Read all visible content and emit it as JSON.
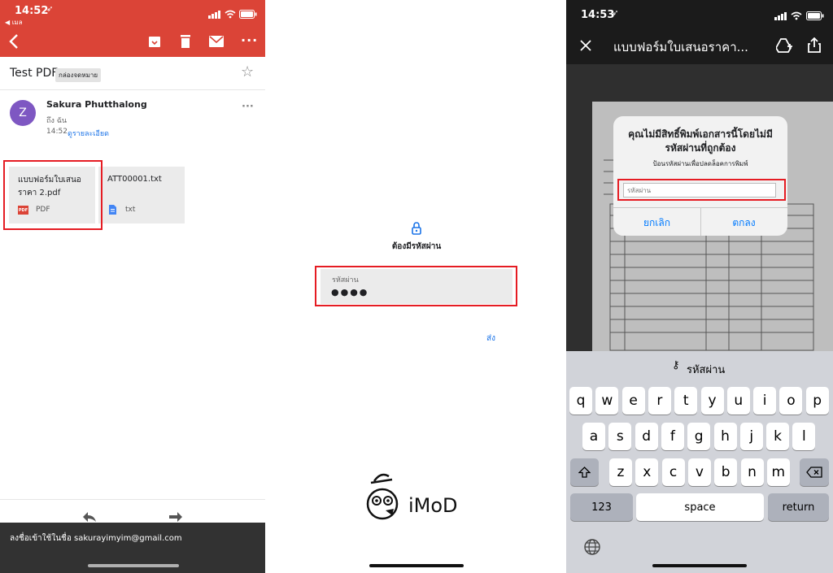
{
  "gmail": {
    "status": {
      "time": "14:52",
      "back_app": "◀ เมล"
    },
    "toolbar": {
      "back_icon": "chevron-left-icon",
      "archive_icon": "archive-icon",
      "delete_icon": "trash-icon",
      "mail_icon": "mail-icon",
      "more_icon": "more-icon"
    },
    "subject": "Test PDF",
    "label_badge": "กล่องจดหมาย",
    "sender": {
      "avatar_letter": "Z",
      "name": "Sakura Phutthalong",
      "to": "ถึง ฉัน",
      "time": "14:52",
      "details_link": "ดูรายละเอียด"
    },
    "attachments": [
      {
        "name": "แบบฟอร์มใบเสนอราคา 2.pdf",
        "type": "PDF"
      },
      {
        "name": "ATT00001.txt",
        "type": "txt"
      }
    ],
    "signin_text": "ลงชื่อเข้าใช้ในชื่อ sakurayimyim@gmail.com"
  },
  "password_page": {
    "title": "ต้องมีรหัสผ่าน",
    "field_label": "รหัสผ่าน",
    "field_value": "●●●●",
    "send_link": "ส่ง",
    "logo_text": "iMoD"
  },
  "viewer": {
    "status": {
      "time": "14:53"
    },
    "title": "แบบฟอร์มใบเสนอราคา...",
    "dialog": {
      "title": "คุณไม่มีสิทธิ์พิมพ์เอกสารนี้โดยไม่มีรหัสผ่านที่ถูกต้อง",
      "message": "ป้อนรหัสผ่านเพื่อปลดล็อคการพิมพ์",
      "placeholder": "รหัสผ่าน",
      "cancel": "ยกเลิก",
      "ok": "ตกลง"
    },
    "keyboard": {
      "suggestion": "รหัสผ่าน",
      "row1": [
        "q",
        "w",
        "e",
        "r",
        "t",
        "y",
        "u",
        "i",
        "o",
        "p"
      ],
      "row2": [
        "a",
        "s",
        "d",
        "f",
        "g",
        "h",
        "j",
        "k",
        "l"
      ],
      "row3": [
        "z",
        "x",
        "c",
        "v",
        "b",
        "n",
        "m"
      ],
      "numbers": "123",
      "space": "space",
      "return": "return"
    }
  },
  "colors": {
    "gmail_red": "#db4437",
    "highlight_red": "#e51c23",
    "link_blue": "#1a73e8",
    "ios_blue": "#007aff"
  }
}
